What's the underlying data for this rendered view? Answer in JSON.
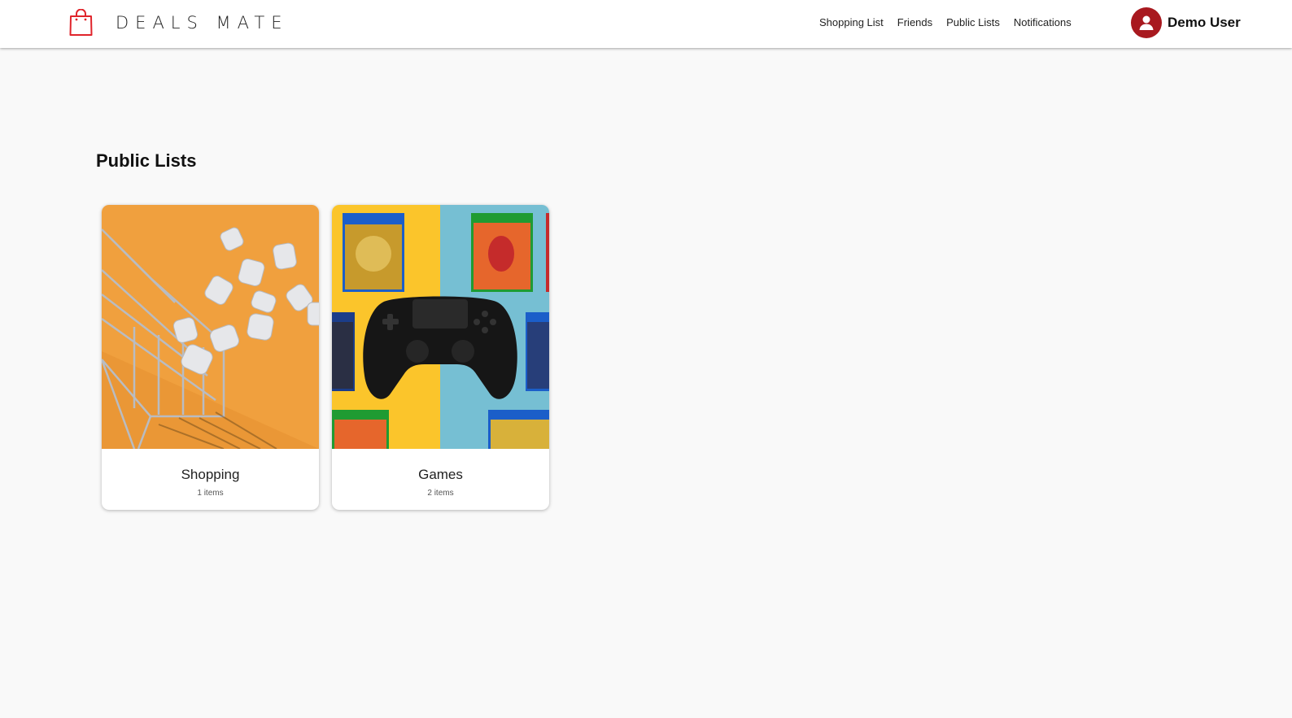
{
  "brand": {
    "name": "DEALS MATE",
    "icon": "shopping-bag-icon",
    "accent_color": "#e0242b"
  },
  "nav": {
    "links": [
      {
        "label": "Shopping List"
      },
      {
        "label": "Friends"
      },
      {
        "label": "Public Lists"
      },
      {
        "label": "Notifications"
      }
    ]
  },
  "user": {
    "name": "Demo User",
    "icon": "user-avatar-icon",
    "avatar_color": "#a8191f"
  },
  "page": {
    "title": "Public Lists"
  },
  "lists": [
    {
      "title": "Shopping",
      "count": "1 items",
      "image": "shopping-cart-bottles-image"
    },
    {
      "title": "Games",
      "count": "2 items",
      "image": "game-controller-image"
    }
  ]
}
